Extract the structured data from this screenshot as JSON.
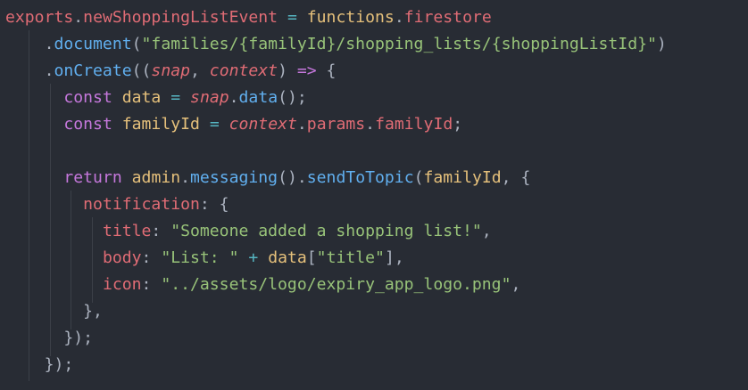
{
  "editor": {
    "theme": {
      "background": "#282c34",
      "identifier": "#e06c75",
      "function": "#61afef",
      "string": "#98c379",
      "keyword": "#c678dd",
      "variable": "#e5c07b",
      "operator": "#56b6c2",
      "punctuation": "#abb2bf",
      "indent_guide": "#3b4048"
    },
    "lines": [
      [
        {
          "text": "exports",
          "t": "id"
        },
        {
          "text": ".",
          "t": "plain"
        },
        {
          "text": "newShoppingListEvent",
          "t": "id"
        },
        {
          "text": " ",
          "t": "plain"
        },
        {
          "text": "=",
          "t": "op"
        },
        {
          "text": " ",
          "t": "plain"
        },
        {
          "text": "functions",
          "t": "var"
        },
        {
          "text": ".",
          "t": "plain"
        },
        {
          "text": "firestore",
          "t": "id"
        }
      ],
      [
        {
          "text": "    .",
          "t": "plain"
        },
        {
          "text": "document",
          "t": "fn"
        },
        {
          "text": "(",
          "t": "plain"
        },
        {
          "text": "\"families/{familyId}/shopping_lists/{shoppingListId}\"",
          "t": "str"
        },
        {
          "text": ")",
          "t": "plain"
        }
      ],
      [
        {
          "text": "    .",
          "t": "plain"
        },
        {
          "text": "onCreate",
          "t": "fn"
        },
        {
          "text": "((",
          "t": "plain"
        },
        {
          "text": "snap",
          "t": "param"
        },
        {
          "text": ", ",
          "t": "plain"
        },
        {
          "text": "context",
          "t": "param"
        },
        {
          "text": ") ",
          "t": "plain"
        },
        {
          "text": "=>",
          "t": "kw"
        },
        {
          "text": " {",
          "t": "plain"
        }
      ],
      [
        {
          "text": "      ",
          "t": "plain"
        },
        {
          "text": "const",
          "t": "kw"
        },
        {
          "text": " ",
          "t": "plain"
        },
        {
          "text": "data",
          "t": "var"
        },
        {
          "text": " ",
          "t": "plain"
        },
        {
          "text": "=",
          "t": "op"
        },
        {
          "text": " ",
          "t": "plain"
        },
        {
          "text": "snap",
          "t": "param"
        },
        {
          "text": ".",
          "t": "plain"
        },
        {
          "text": "data",
          "t": "fn"
        },
        {
          "text": "();",
          "t": "plain"
        }
      ],
      [
        {
          "text": "      ",
          "t": "plain"
        },
        {
          "text": "const",
          "t": "kw"
        },
        {
          "text": " ",
          "t": "plain"
        },
        {
          "text": "familyId",
          "t": "var"
        },
        {
          "text": " ",
          "t": "plain"
        },
        {
          "text": "=",
          "t": "op"
        },
        {
          "text": " ",
          "t": "plain"
        },
        {
          "text": "context",
          "t": "param"
        },
        {
          "text": ".",
          "t": "plain"
        },
        {
          "text": "params",
          "t": "id"
        },
        {
          "text": ".",
          "t": "plain"
        },
        {
          "text": "familyId",
          "t": "id"
        },
        {
          "text": ";",
          "t": "plain"
        }
      ],
      [],
      [
        {
          "text": "      ",
          "t": "plain"
        },
        {
          "text": "return",
          "t": "kw"
        },
        {
          "text": " ",
          "t": "plain"
        },
        {
          "text": "admin",
          "t": "var"
        },
        {
          "text": ".",
          "t": "plain"
        },
        {
          "text": "messaging",
          "t": "fn"
        },
        {
          "text": "().",
          "t": "plain"
        },
        {
          "text": "sendToTopic",
          "t": "fn"
        },
        {
          "text": "(",
          "t": "plain"
        },
        {
          "text": "familyId",
          "t": "var"
        },
        {
          "text": ", {",
          "t": "plain"
        }
      ],
      [
        {
          "text": "        ",
          "t": "plain"
        },
        {
          "text": "notification",
          "t": "id"
        },
        {
          "text": ": {",
          "t": "plain"
        }
      ],
      [
        {
          "text": "          ",
          "t": "plain"
        },
        {
          "text": "title",
          "t": "id"
        },
        {
          "text": ": ",
          "t": "plain"
        },
        {
          "text": "\"Someone added a shopping list!\"",
          "t": "str"
        },
        {
          "text": ",",
          "t": "plain"
        }
      ],
      [
        {
          "text": "          ",
          "t": "plain"
        },
        {
          "text": "body",
          "t": "id"
        },
        {
          "text": ": ",
          "t": "plain"
        },
        {
          "text": "\"List: \"",
          "t": "str"
        },
        {
          "text": " ",
          "t": "plain"
        },
        {
          "text": "+",
          "t": "op"
        },
        {
          "text": " ",
          "t": "plain"
        },
        {
          "text": "data",
          "t": "var"
        },
        {
          "text": "[",
          "t": "plain"
        },
        {
          "text": "\"title\"",
          "t": "str"
        },
        {
          "text": "],",
          "t": "plain"
        }
      ],
      [
        {
          "text": "          ",
          "t": "plain"
        },
        {
          "text": "icon",
          "t": "id"
        },
        {
          "text": ": ",
          "t": "plain"
        },
        {
          "text": "\"../assets/logo/expiry_app_logo.png\"",
          "t": "str"
        },
        {
          "text": ",",
          "t": "plain"
        }
      ],
      [
        {
          "text": "        },",
          "t": "plain"
        }
      ],
      [
        {
          "text": "      });",
          "t": "plain"
        }
      ],
      [
        {
          "text": "    });",
          "t": "plain"
        }
      ]
    ]
  }
}
